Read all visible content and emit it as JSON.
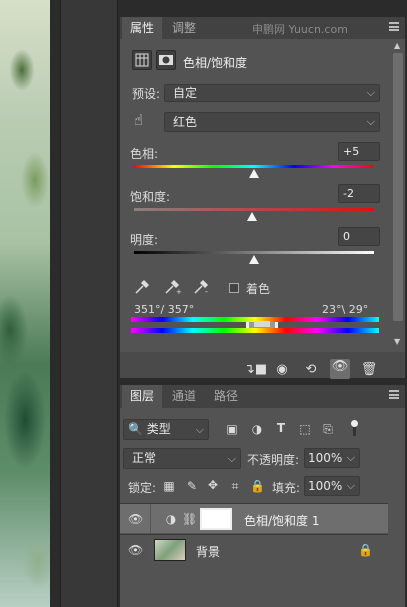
{
  "watermark": "申鹏网 Yuucn.com",
  "properties": {
    "tabs": [
      "属性",
      "调整"
    ],
    "title": "色相/饱和度",
    "preset_label": "预设:",
    "preset_value": "自定",
    "channel_value": "红色",
    "hue_label": "色相:",
    "hue_value": "+5",
    "saturation_label": "饱和度:",
    "saturation_value": "-2",
    "lightness_label": "明度:",
    "lightness_value": "0",
    "colorize_label": "着色",
    "range_left": "351°/ 357°",
    "range_right": "23°\\ 29°",
    "hue_fraction": 0.5,
    "saturation_fraction": 0.49,
    "lightness_fraction": 0.5
  },
  "layers": {
    "tabs": [
      "图层",
      "通道",
      "路径"
    ],
    "filter_value": "类型",
    "blend_mode": "正常",
    "opacity_label": "不透明度:",
    "opacity_value": "100%",
    "lock_label": "锁定:",
    "fill_label": "填充:",
    "fill_value": "100%",
    "items": [
      {
        "name": "色相/饱和度 1",
        "selected": true
      },
      {
        "name": "背景",
        "selected": false
      }
    ]
  },
  "icons": [
    "grid-icon",
    "mask-icon",
    "hand-icon",
    "eyedropper-icon",
    "eyedropper-plus-icon",
    "eyedropper-minus-icon",
    "clip-icon",
    "visibility-icon",
    "reset-icon",
    "eye-icon",
    "trash-icon",
    "image-icon",
    "circle-half-icon",
    "text-icon",
    "transform-icon",
    "smart-icon",
    "lock-icon",
    "move-icon",
    "crop-icon",
    "brush-icon",
    "checker-icon",
    "link-icon",
    "menu-icon"
  ],
  "colors": {
    "panel": "#535353",
    "selected_row": "#6e6e6e",
    "tab_bar": "#424242"
  }
}
